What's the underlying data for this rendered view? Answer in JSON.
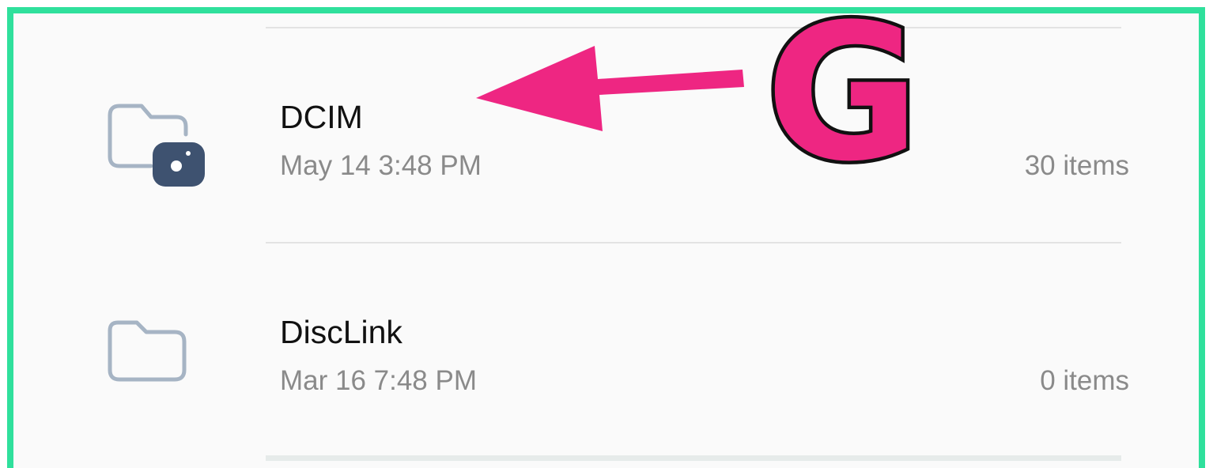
{
  "list": {
    "rows": [
      {
        "title": "DCIM",
        "date": "May 14 3:48 PM",
        "count": "30 items",
        "icon": "camera-folder-icon"
      },
      {
        "title": "DiscLink",
        "date": "Mar 16 7:48 PM",
        "count": "0 items",
        "icon": "folder-icon"
      }
    ]
  },
  "annotation": {
    "step_letter": "G",
    "accent_color": "#ee2682",
    "frame_color": "#2fe09c",
    "arrow": "arrow-left-icon"
  }
}
